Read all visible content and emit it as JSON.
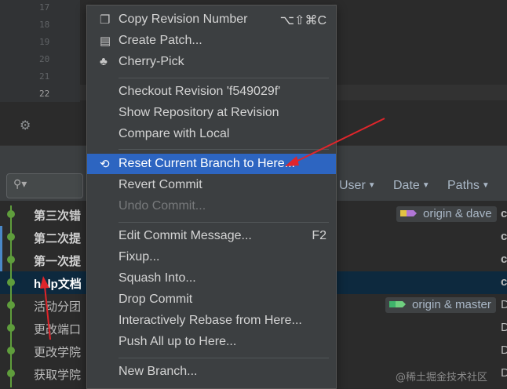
{
  "editor": {
    "line_numbers": [
      "17",
      "18",
      "19",
      "20",
      "21",
      "22"
    ],
    "settings_icon": "gear-icon"
  },
  "filters": {
    "search_icon": "search-icon",
    "user": "User",
    "date": "Date",
    "paths": "Paths"
  },
  "commits": [
    {
      "subject": "第三次错",
      "tag": "origin & dave",
      "right": "c"
    },
    {
      "subject": "第二次提",
      "right": "c"
    },
    {
      "subject": "第一次提",
      "right": "c"
    },
    {
      "subject": "help文档",
      "right": "c"
    },
    {
      "subject": "活动分团",
      "tag": "origin & master",
      "right": "D"
    },
    {
      "subject": "更改端口",
      "right": "D"
    },
    {
      "subject": "更改学院",
      "right": "D"
    },
    {
      "subject": "获取学院",
      "right": "D"
    }
  ],
  "context_menu": {
    "items": [
      {
        "label": "Copy Revision Number",
        "shortcut": "⌥⇧⌘C",
        "icon": "copy-icon"
      },
      {
        "label": "Create Patch...",
        "icon": "patch-icon"
      },
      {
        "label": "Cherry-Pick",
        "icon": "cherry-icon"
      },
      {
        "label": "Checkout Revision 'f549029f'"
      },
      {
        "label": "Show Repository at Revision"
      },
      {
        "label": "Compare with Local"
      },
      {
        "label": "Reset Current Branch to Here...",
        "icon": "undo-icon",
        "state": "highlighted"
      },
      {
        "label": "Revert Commit"
      },
      {
        "label": "Undo Commit...",
        "state": "disabled"
      },
      {
        "label": "Edit Commit Message...",
        "shortcut": "F2"
      },
      {
        "label": "Fixup..."
      },
      {
        "label": "Squash Into..."
      },
      {
        "label": "Drop Commit"
      },
      {
        "label": "Interactively Rebase from Here..."
      },
      {
        "label": "Push All up to Here..."
      },
      {
        "label": "New Branch..."
      }
    ]
  },
  "watermark": "@稀土掘金技术社区",
  "colors": {
    "menu_highlight": "#2d65c1",
    "selected_row": "#0d293e",
    "graph_green": "#5f9d3c",
    "annotation_red": "#e0252b"
  }
}
